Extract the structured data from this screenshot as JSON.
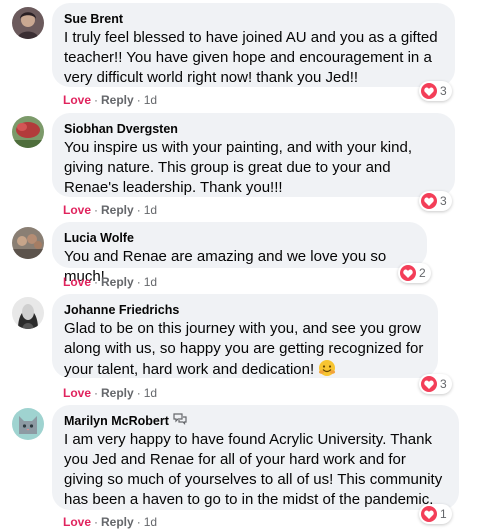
{
  "comments": [
    {
      "name": "Sue Brent",
      "text": "I truly feel blessed to have joined AU and you as a gifted teacher!! You have given hope and encouragement in a very difficult world right now! thank you Jed!!",
      "love": "Love",
      "reply": "Reply",
      "time": "1d",
      "reaction_count": "3"
    },
    {
      "name": "Siobhan Dvergsten",
      "text": "You inspire us with your painting, and with your kind, giving nature. This group is great due to your and Renae's leadership. Thank you!!!",
      "love": "Love",
      "reply": "Reply",
      "time": "1d",
      "reaction_count": "3"
    },
    {
      "name": "Lucia Wolfe",
      "text": "You and Renae are amazing and we love you so much!",
      "love": "Love",
      "reply": "Reply",
      "time": "1d",
      "reaction_count": "2"
    },
    {
      "name": "Johanne Friedrichs",
      "text": "Glad to be on this journey with you, and see you grow along with us, so happy you are getting recognized for your talent, hard work and dedication!",
      "love": "Love",
      "reply": "Reply",
      "time": "1d",
      "reaction_count": "3",
      "emoji": "hugging-face-emoji"
    },
    {
      "name": "Marilyn McRobert",
      "text": "I am very happy to have found Acrylic University. Thank you Jed and Renae for all of your hard work and for giving so much of yourselves to all of us! This community has been a haven to go to in the midst of the pandemic.",
      "love": "Love",
      "reply": "Reply",
      "time": "1d",
      "reaction_count": "1",
      "badge": "conversation-starter-badge-icon"
    }
  ],
  "colors": {
    "bubble": "#f0f2f5",
    "love_text": "#e0245e",
    "heart": "#f33e58",
    "muted": "#65676b"
  }
}
